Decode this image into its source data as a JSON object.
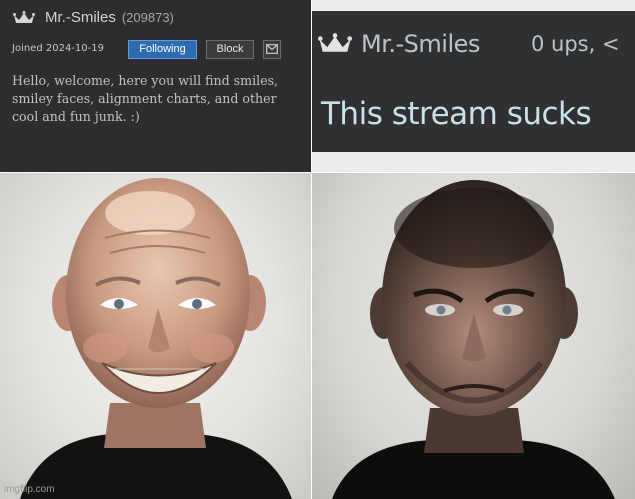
{
  "profile": {
    "username": "Mr.-Smiles",
    "user_id": "(209873)",
    "joined": "Joined 2024-10-19",
    "following_label": "Following",
    "block_label": "Block",
    "message_icon": "envelope-icon",
    "crown_icon": "crown-icon",
    "bio": "Hello, welcome, here you will find smiles, smiley faces, alignment charts, and other cool and fun junk. :)"
  },
  "chat": {
    "username": "Mr.-Smiles",
    "ups_text": "0 ups, <",
    "message": "This stream sucks"
  },
  "watermark": "imgflip.com",
  "colors": {
    "profile_bg": "#2d2d2f",
    "following_button": "#2b6cb2",
    "chat_bg": "#2f3031",
    "chat_message": "#c9e2ea"
  }
}
